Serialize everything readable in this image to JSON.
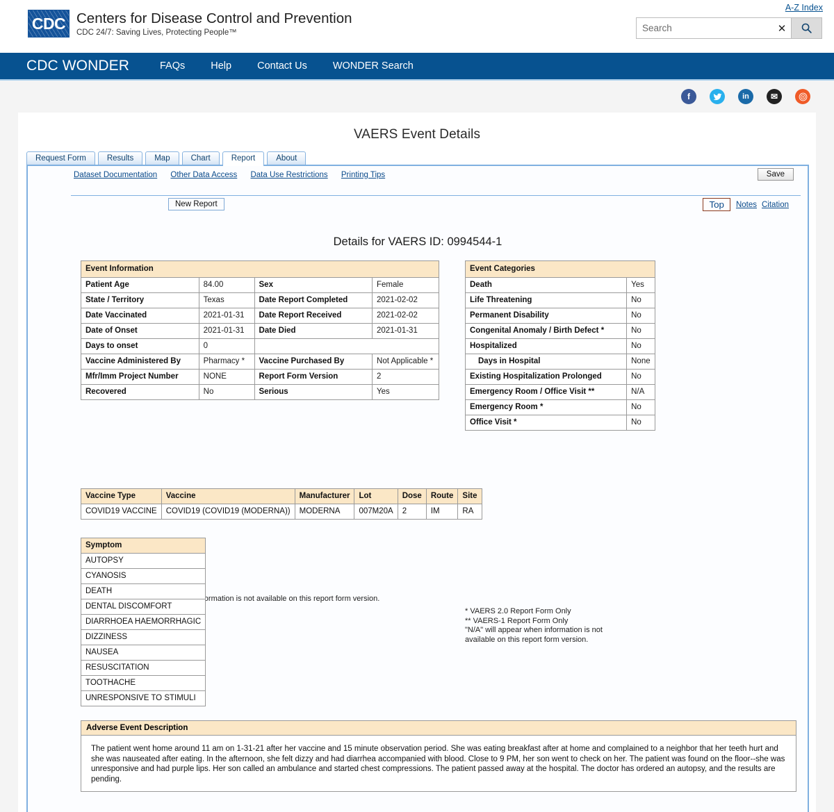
{
  "header": {
    "az_index": "A-Z Index",
    "org_title": "Centers for Disease Control and Prevention",
    "org_tagline": "CDC 24/7: Saving Lives, Protecting People™",
    "logo_text": "CDC",
    "search_placeholder": "Search",
    "search_value": "",
    "clear_glyph": "✕"
  },
  "nav": {
    "brand": "CDC WONDER",
    "links": [
      {
        "label": "FAQs"
      },
      {
        "label": "Help"
      },
      {
        "label": "Contact Us"
      },
      {
        "label": "WONDER Search"
      }
    ]
  },
  "social": [
    {
      "name": "facebook",
      "glyph": "f",
      "color": "#3b5998"
    },
    {
      "name": "twitter",
      "glyph": "ᵛ",
      "color": "#29b0ed"
    },
    {
      "name": "linkedin",
      "glyph": "in",
      "color": "#1a6aa8"
    },
    {
      "name": "email",
      "glyph": "✉",
      "color": "#222222"
    },
    {
      "name": "syndication",
      "glyph": "⌘",
      "color": "#f05b28"
    }
  ],
  "page": {
    "heading": "VAERS Event Details",
    "details_title": "Details for VAERS ID: 0994544-1"
  },
  "tabs": [
    {
      "label": "Request Form",
      "active": false
    },
    {
      "label": "Results",
      "active": false
    },
    {
      "label": "Map",
      "active": false
    },
    {
      "label": "Chart",
      "active": false
    },
    {
      "label": "Report",
      "active": true
    },
    {
      "label": "About",
      "active": false
    }
  ],
  "toolbar": {
    "links": [
      {
        "label": "Dataset Documentation"
      },
      {
        "label": "Other Data Access"
      },
      {
        "label": "Data Use Restrictions"
      },
      {
        "label": "Printing Tips"
      }
    ],
    "save_label": "Save",
    "new_report_label": "New Report",
    "top_label": "Top",
    "notes_label": "Notes",
    "citation_label": "Citation"
  },
  "event_information": {
    "caption": "Event Information",
    "rows": [
      {
        "label": "Patient Age",
        "value": "84.00",
        "label2": "Sex",
        "value2": "Female"
      },
      {
        "label": "State / Territory",
        "value": "Texas",
        "label2": "Date Report Completed",
        "value2": "2021-02-02"
      },
      {
        "label": "Date Vaccinated",
        "value": "2021-01-31",
        "label2": "Date Report Received",
        "value2": "2021-02-02"
      },
      {
        "label": "Date of Onset",
        "value": "2021-01-31",
        "label2": "Date Died",
        "value2": "2021-01-31"
      },
      {
        "label": "Days to onset",
        "value": "0",
        "label2": "",
        "value2": ""
      },
      {
        "label": "Vaccine Administered By",
        "value": "Pharmacy *",
        "label2": "Vaccine Purchased By",
        "value2": "Not Applicable *"
      },
      {
        "label": "Mfr/Imm Project Number",
        "value": "NONE",
        "label2": "Report Form Version",
        "value2": "2"
      },
      {
        "label": "Recovered",
        "value": "No",
        "label2": "Serious",
        "value2": "Yes"
      }
    ],
    "footnotes": "* VAERS 2.0 Report Form Only\n** VAERS-1 Report Form Only\n\"Not Applicable\" will appear when information is not available on this report form version."
  },
  "event_categories": {
    "caption": "Event Categories",
    "rows": [
      {
        "label": "Death",
        "value": "Yes",
        "indent": false
      },
      {
        "label": "Life Threatening",
        "value": "No",
        "indent": false
      },
      {
        "label": "Permanent Disability",
        "value": "No",
        "indent": false
      },
      {
        "label": "Congenital Anomaly / Birth Defect *",
        "value": "No",
        "indent": false
      },
      {
        "label": "Hospitalized",
        "value": "No",
        "indent": false
      },
      {
        "label": "Days in Hospital",
        "value": "None",
        "indent": true
      },
      {
        "label": "Existing Hospitalization Prolonged",
        "value": "No",
        "indent": false
      },
      {
        "label": "Emergency Room / Office Visit **",
        "value": "N/A",
        "indent": false
      },
      {
        "label": "Emergency Room *",
        "value": "No",
        "indent": false
      },
      {
        "label": "Office Visit *",
        "value": "No",
        "indent": false
      }
    ],
    "footnotes": "* VAERS 2.0 Report Form Only\n** VAERS-1 Report Form Only\n\"N/A\" will appear when information is not\navailable on this report form version."
  },
  "vaccine_table": {
    "columns": [
      "Vaccine Type",
      "Vaccine",
      "Manufacturer",
      "Lot",
      "Dose",
      "Route",
      "Site"
    ],
    "rows": [
      [
        "COVID19 VACCINE",
        "COVID19 (COVID19 (MODERNA))",
        "MODERNA",
        "007M20A",
        "2",
        "IM",
        "RA"
      ]
    ]
  },
  "symptom_table": {
    "header": "Symptom",
    "rows": [
      "AUTOPSY",
      "CYANOSIS",
      "DEATH",
      "DENTAL DISCOMFORT",
      "DIARRHOEA HAEMORRHAGIC",
      "DIZZINESS",
      "NAUSEA",
      "RESUSCITATION",
      "TOOTHACHE",
      "UNRESPONSIVE TO STIMULI"
    ]
  },
  "adverse_event": {
    "header": "Adverse Event Description",
    "text": "The patient went home around 11 am on 1-31-21 after her vaccine and 15 minute observation period. She was eating breakfast after at home and complained to a neighbor that her teeth hurt and she was nauseated after eating. In the afternoon, she felt dizzy and had diarrhea accompanied with blood. Close to 9 PM, her son went to check on her. The patient was found on the floor--she was unresponsive and had purple lips. Her son called an ambulance and started chest compressions. The patient passed away at the hospital. The doctor has ordered an autopsy, and the results are pending."
  }
}
